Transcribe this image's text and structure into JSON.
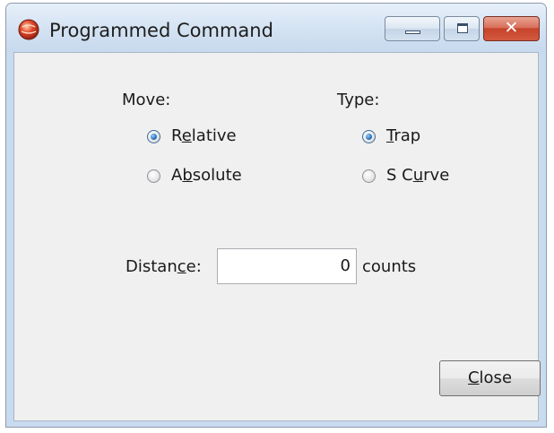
{
  "window": {
    "title": "Programmed Command",
    "close_glyph": "✕"
  },
  "move": {
    "label": "Move:",
    "options": [
      {
        "pre": "R",
        "key": "e",
        "post": "lative",
        "checked": true
      },
      {
        "pre": "A",
        "key": "b",
        "post": "solute",
        "checked": false
      }
    ]
  },
  "type": {
    "label": "Type:",
    "options": [
      {
        "pre": "",
        "key": "T",
        "post": "rap",
        "checked": true
      },
      {
        "pre": "S C",
        "key": "u",
        "post": "rve",
        "checked": false
      }
    ]
  },
  "distance": {
    "label_pre": "Distan",
    "label_key": "c",
    "label_post": "e:",
    "value": "0",
    "unit": "counts"
  },
  "close_button": {
    "pre": "",
    "key": "C",
    "post": "lose"
  },
  "icons": {
    "app": "app-red-globe-icon",
    "minimize": "minimize-icon",
    "maximize": "maximize-icon",
    "close": "close-icon"
  },
  "colors": {
    "titlebar": "#d6e4f3",
    "close_button": "#c6422b",
    "dialog_background": "#f0f0f0",
    "radio_selected": "#2a78c6"
  }
}
